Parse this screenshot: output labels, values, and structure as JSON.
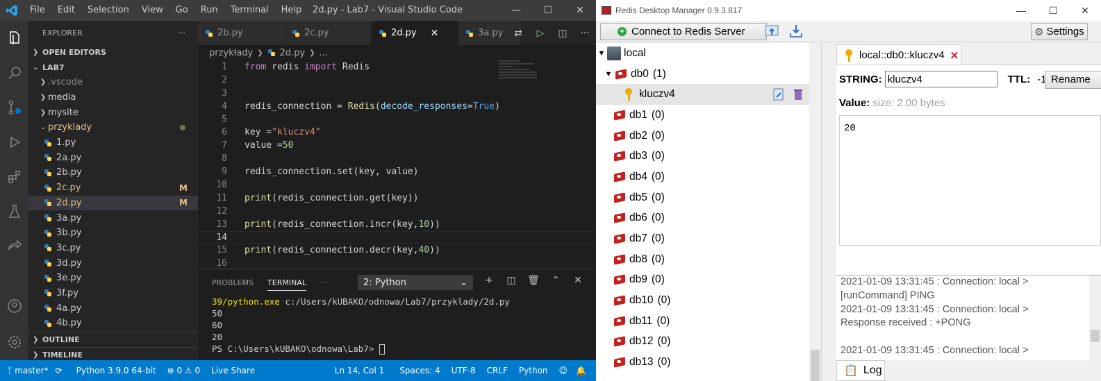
{
  "vscode": {
    "menu": [
      "File",
      "Edit",
      "Selection",
      "View",
      "Go",
      "Run",
      "Terminal",
      "Help"
    ],
    "window_title": "2d.py - Lab7 - Visual Studio Code",
    "explorer": {
      "title": "EXPLORER",
      "open_editors": "OPEN EDITORS",
      "root": "LAB7",
      "outline": "OUTLINE",
      "timeline": "TIMELINE",
      "items": [
        {
          "label": ".vscode",
          "type": "folder",
          "indent": 1
        },
        {
          "label": "media",
          "type": "folder",
          "indent": 1
        },
        {
          "label": "mysite",
          "type": "folder",
          "indent": 1
        },
        {
          "label": "przyklady",
          "type": "folder-open",
          "indent": 1,
          "modified": true
        },
        {
          "label": "1.py",
          "type": "py",
          "indent": 2
        },
        {
          "label": "2a.py",
          "type": "py",
          "indent": 2
        },
        {
          "label": "2b.py",
          "type": "py",
          "indent": 2
        },
        {
          "label": "2c.py",
          "type": "py",
          "indent": 2,
          "badge": "M"
        },
        {
          "label": "2d.py",
          "type": "py",
          "indent": 2,
          "badge": "M",
          "selected": true
        },
        {
          "label": "3a.py",
          "type": "py",
          "indent": 2
        },
        {
          "label": "3b.py",
          "type": "py",
          "indent": 2
        },
        {
          "label": "3c.py",
          "type": "py",
          "indent": 2
        },
        {
          "label": "3d.py",
          "type": "py",
          "indent": 2
        },
        {
          "label": "3e.py",
          "type": "py",
          "indent": 2
        },
        {
          "label": "3f.py",
          "type": "py",
          "indent": 2
        },
        {
          "label": "4a.py",
          "type": "py",
          "indent": 2
        },
        {
          "label": "4b.py",
          "type": "py",
          "indent": 2
        }
      ]
    },
    "tabs": [
      {
        "label": "2b.py",
        "active": false
      },
      {
        "label": "2c.py",
        "active": false
      },
      {
        "label": "2d.py",
        "active": true
      },
      {
        "label": "3a.py",
        "active": false
      }
    ],
    "breadcrumb": [
      "przykłady",
      "2d.py",
      "..."
    ],
    "code_lines": [
      "from redis import Redis",
      "",
      "",
      "redis_connection = Redis(decode_responses=True)",
      "",
      "key =\"kluczv4\"",
      "value =50",
      "",
      "redis_connection.set(key, value)",
      "",
      "print(redis_connection.get(key))",
      "",
      "print(redis_connection.incr(key,10))",
      "",
      "print(redis_connection.decr(key,40))",
      ""
    ],
    "current_line": 14,
    "panel": {
      "tabs": [
        "PROBLEMS",
        "TERMINAL"
      ],
      "active_tab": "TERMINAL",
      "terminal_select": "2: Python",
      "lines": [
        {
          "prefix": "39/python.exe",
          "rest": " c:/Users/kUBAKO/odnowa/Lab7/przyklady/2d.py"
        },
        {
          "prefix": "",
          "rest": "50"
        },
        {
          "prefix": "",
          "rest": "60"
        },
        {
          "prefix": "",
          "rest": "20"
        },
        {
          "prefix": "",
          "rest": "PS C:\\Users\\kUBAKO\\odnowa\\Lab7> "
        }
      ]
    },
    "status": {
      "branch": "master*",
      "python": "Python 3.9.0 64-bit",
      "problems": "⊗ 0 ⚠ 0",
      "live_share": "Live Share",
      "position": "Ln 14, Col 1",
      "spaces": "Spaces: 4",
      "encoding": "UTF-8",
      "eol": "CRLF",
      "language": "Python"
    }
  },
  "rdm": {
    "title": "Redis Desktop Manager 0.9.3.817",
    "connect_label": "Connect to Redis Server",
    "settings_label": "Settings",
    "server": "local",
    "databases": [
      {
        "name": "db0",
        "count": "(1)",
        "expanded": true
      },
      {
        "name": "db1",
        "count": "(0)"
      },
      {
        "name": "db2",
        "count": "(0)"
      },
      {
        "name": "db3",
        "count": "(0)"
      },
      {
        "name": "db4",
        "count": "(0)"
      },
      {
        "name": "db5",
        "count": "(0)"
      },
      {
        "name": "db6",
        "count": "(0)"
      },
      {
        "name": "db7",
        "count": "(0)"
      },
      {
        "name": "db8",
        "count": "(0)"
      },
      {
        "name": "db9",
        "count": "(0)"
      },
      {
        "name": "db10",
        "count": "(0)"
      },
      {
        "name": "db11",
        "count": "(0)"
      },
      {
        "name": "db12",
        "count": "(0)"
      },
      {
        "name": "db13",
        "count": "(0)"
      }
    ],
    "key_name": "kluczv4",
    "key_tab": "local::db0::kluczv4",
    "type_label": "STRING:",
    "ttl_label": "TTL:",
    "ttl_value": "-1",
    "rename_label": "Rename",
    "value_label": "Value:",
    "value_hint": "size: 2.00 bytes",
    "value": "20",
    "log_lines": [
      "2021-01-09 13:31:45 : Connection: local >",
      "[runCommand] PING",
      "2021-01-09 13:31:45 : Connection: local >",
      "Response received : +PONG",
      "",
      "2021-01-09 13:31:45 : Connection: local >"
    ],
    "log_tab": "Log"
  }
}
